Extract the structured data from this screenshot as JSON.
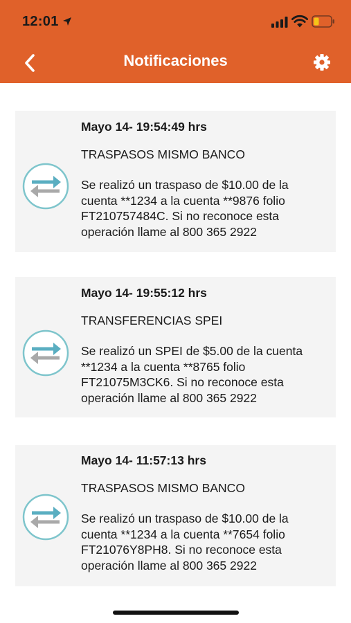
{
  "status_bar": {
    "time": "12:01"
  },
  "header": {
    "title": "Notificaciones",
    "back_icon": "chevron-left-icon",
    "settings_icon": "gear-icon",
    "background_color": "#e0612a"
  },
  "notifications": [
    {
      "date": "Mayo 14- 19:54:49 hrs",
      "title": "TRASPASOS MISMO BANCO",
      "body": "Se realizó un traspaso de $10.00 de la\ncuenta **1234 a la cuenta **9876 folio\nFT210757484C. Si no reconoce esta\noperación llame al 800 365 2922",
      "icon": "transfer-arrows-icon"
    },
    {
      "date": "Mayo 14- 19:55:12 hrs",
      "title": "TRANSFERENCIAS SPEI",
      "body": "Se realizó un SPEI de $5.00 de la cuenta\n**1234 a la cuenta **8765 folio\nFT21075M3CK6. Si no reconoce esta\noperación llame al 800 365 2922",
      "icon": "transfer-arrows-icon"
    },
    {
      "date": "Mayo 14- 11:57:13 hrs",
      "title": "TRASPASOS MISMO BANCO",
      "body": "Se realizó un traspaso de $10.00 de la\ncuenta **1234 a la cuenta **7654 folio\nFT21076Y8PH8. Si no reconoce esta\noperación llame al 800 365 2922",
      "icon": "transfer-arrows-icon"
    }
  ]
}
